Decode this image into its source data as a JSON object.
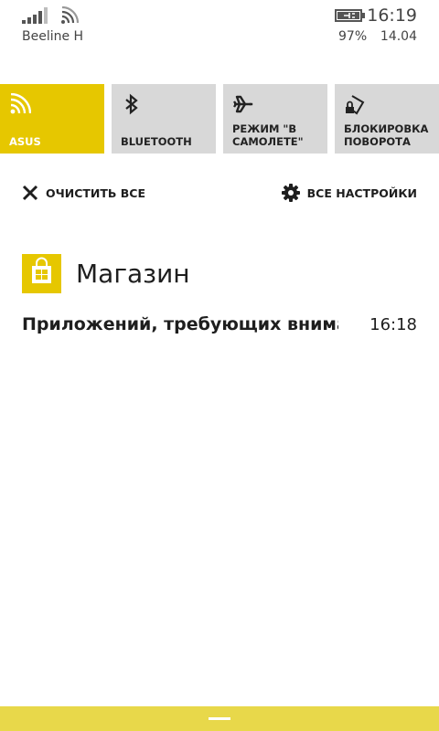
{
  "status_bar": {
    "carrier": "Beeline H",
    "time": "16:19",
    "battery_percent": "97%",
    "date": "14.04",
    "signal_bars_filled": 4,
    "signal_bars_total": 5
  },
  "quick_actions": [
    {
      "label": "ASUS",
      "icon": "wifi-icon",
      "active": true
    },
    {
      "label": "BLUETOOTH",
      "icon": "bluetooth-icon",
      "active": false
    },
    {
      "label": "РЕЖИМ \"В САМОЛЕТЕ\"",
      "icon": "airplane-icon",
      "active": false
    },
    {
      "label": "БЛОКИРОВКА ПОВОРОТА",
      "icon": "rotation-lock-icon",
      "active": false
    }
  ],
  "actions": {
    "clear_all": "ОЧИСТИТЬ ВСЕ",
    "all_settings": "ВСЕ НАСТРОЙКИ"
  },
  "notifications": {
    "app_name": "Магазин",
    "app_icon": "store-bag-icon",
    "items": [
      {
        "text": "Приложений, требующих внима",
        "time": "16:18"
      }
    ]
  },
  "colors": {
    "accent": "#e6c700",
    "tile_inactive": "#d8d8d8",
    "handle_bar": "#e8d84a"
  }
}
